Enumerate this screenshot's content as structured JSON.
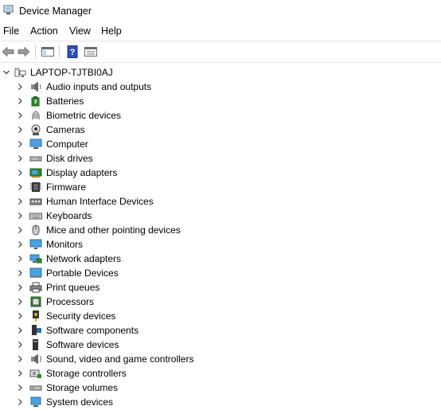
{
  "window": {
    "title": "Device Manager"
  },
  "menu": [
    "File",
    "Action",
    "View",
    "Help"
  ],
  "tree": {
    "root": "LAPTOP-TJTBI0AJ",
    "items": [
      {
        "label": "Audio inputs and outputs",
        "icon": "speaker-icon"
      },
      {
        "label": "Batteries",
        "icon": "battery-icon"
      },
      {
        "label": "Biometric devices",
        "icon": "fingerprint-icon"
      },
      {
        "label": "Cameras",
        "icon": "camera-icon"
      },
      {
        "label": "Computer",
        "icon": "computer-icon"
      },
      {
        "label": "Disk drives",
        "icon": "disk-drive-icon"
      },
      {
        "label": "Display adapters",
        "icon": "display-adapter-icon"
      },
      {
        "label": "Firmware",
        "icon": "firmware-chip-icon"
      },
      {
        "label": "Human Interface Devices",
        "icon": "hid-icon"
      },
      {
        "label": "Keyboards",
        "icon": "keyboard-icon"
      },
      {
        "label": "Mice and other pointing devices",
        "icon": "mouse-icon"
      },
      {
        "label": "Monitors",
        "icon": "monitor-icon"
      },
      {
        "label": "Network adapters",
        "icon": "network-adapter-icon"
      },
      {
        "label": "Portable Devices",
        "icon": "portable-device-icon"
      },
      {
        "label": "Print queues",
        "icon": "printer-icon"
      },
      {
        "label": "Processors",
        "icon": "processor-icon"
      },
      {
        "label": "Security devices",
        "icon": "security-key-icon"
      },
      {
        "label": "Software components",
        "icon": "software-component-icon"
      },
      {
        "label": "Software devices",
        "icon": "software-device-icon"
      },
      {
        "label": "Sound, video and game controllers",
        "icon": "sound-icon"
      },
      {
        "label": "Storage controllers",
        "icon": "storage-controller-icon"
      },
      {
        "label": "Storage volumes",
        "icon": "storage-volume-icon"
      },
      {
        "label": "System devices",
        "icon": "system-device-icon"
      }
    ]
  }
}
